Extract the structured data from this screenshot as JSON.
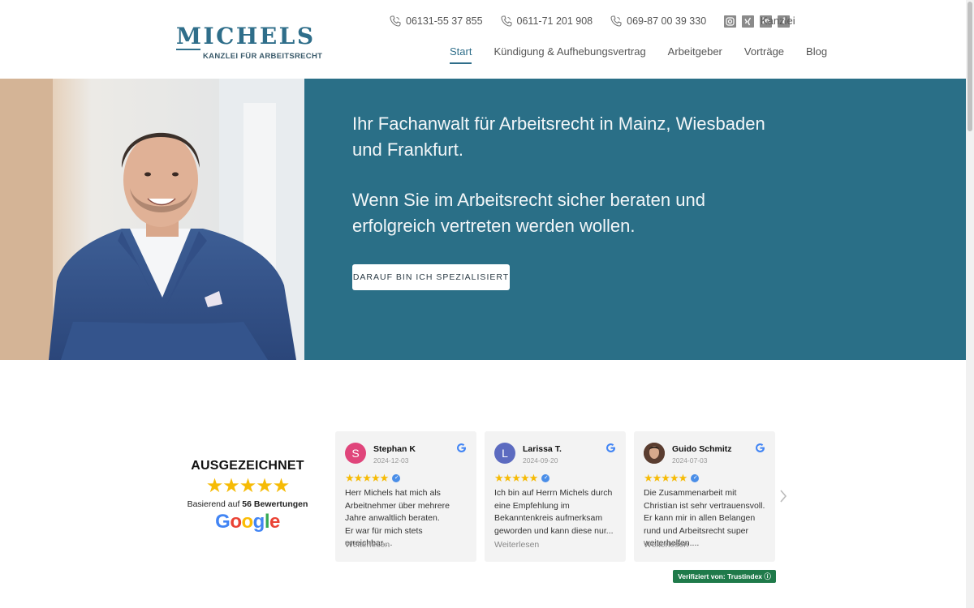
{
  "header": {
    "logo": {
      "name": "MICHELS",
      "tagline": "KANZLEI FÜR ARBEITSRECHT"
    },
    "phones": [
      "06131-55 37 855",
      "0611-71 201 908",
      "069-87 00 39 330"
    ],
    "social": [
      "instagram-icon",
      "xing-icon",
      "linkedin-icon",
      "facebook-icon"
    ],
    "kanzlei_link": "Kanzlei",
    "nav": [
      "Start",
      "Kündigung & Aufhebungsvertrag",
      "Arbeitgeber",
      "Vorträge",
      "Blog"
    ],
    "active_nav": "Start"
  },
  "hero": {
    "headline": "Ihr Fachanwalt für Arbeitsrecht in Mainz, Wiesbaden und Frankfurt.",
    "subline": "Wenn Sie im Arbeitsrecht sicher beraten und erfolgreich vertreten werden wollen.",
    "cta_label": "DARAUF BIN ICH SPEZIALISIERT"
  },
  "reviews": {
    "summary": {
      "title": "AUSGEZEICHNET",
      "stars": "★★★★★",
      "based_prefix": "Basierend auf",
      "based_count": "56 Bewertungen",
      "brand": "Google"
    },
    "cards": [
      {
        "initial": "S",
        "avatar_color": "#e0457b",
        "name": "Stephan K",
        "date": "2024-12-03",
        "stars": "★★★★★",
        "text": "Herr Michels hat mich als Arbeitnehmer über mehrere Jahre anwaltlich beraten.\nEr war für mich stets erreichbar....",
        "more": "Weiterlesen"
      },
      {
        "initial": "L",
        "avatar_color": "#5c6bc0",
        "name": "Larissa T.",
        "date": "2024-09-20",
        "stars": "★★★★★",
        "text": "Ich bin auf Herrn Michels durch eine Empfehlung im Bekanntenkreis aufmerksam geworden und kann diese nur...",
        "more": "Weiterlesen"
      },
      {
        "initial": "",
        "avatar_color": "#6b4a3a",
        "name": "Guido Schmitz",
        "date": "2024-07-03",
        "stars": "★★★★★",
        "text": "Die Zusammenarbeit mit Christian ist sehr vertrauensvoll. Er kann mir in allen Belangen rund und Arbeitsrecht super weiterhelfen....",
        "more": "Weiterlesen"
      }
    ],
    "verified_badge": "Verifiziert von: Trustindex ⓘ"
  },
  "colors": {
    "brand": "#2f6e8a",
    "hero_bg": "#2a6f87",
    "star": "#f6bb06",
    "trust_green": "#1f7a4a"
  }
}
